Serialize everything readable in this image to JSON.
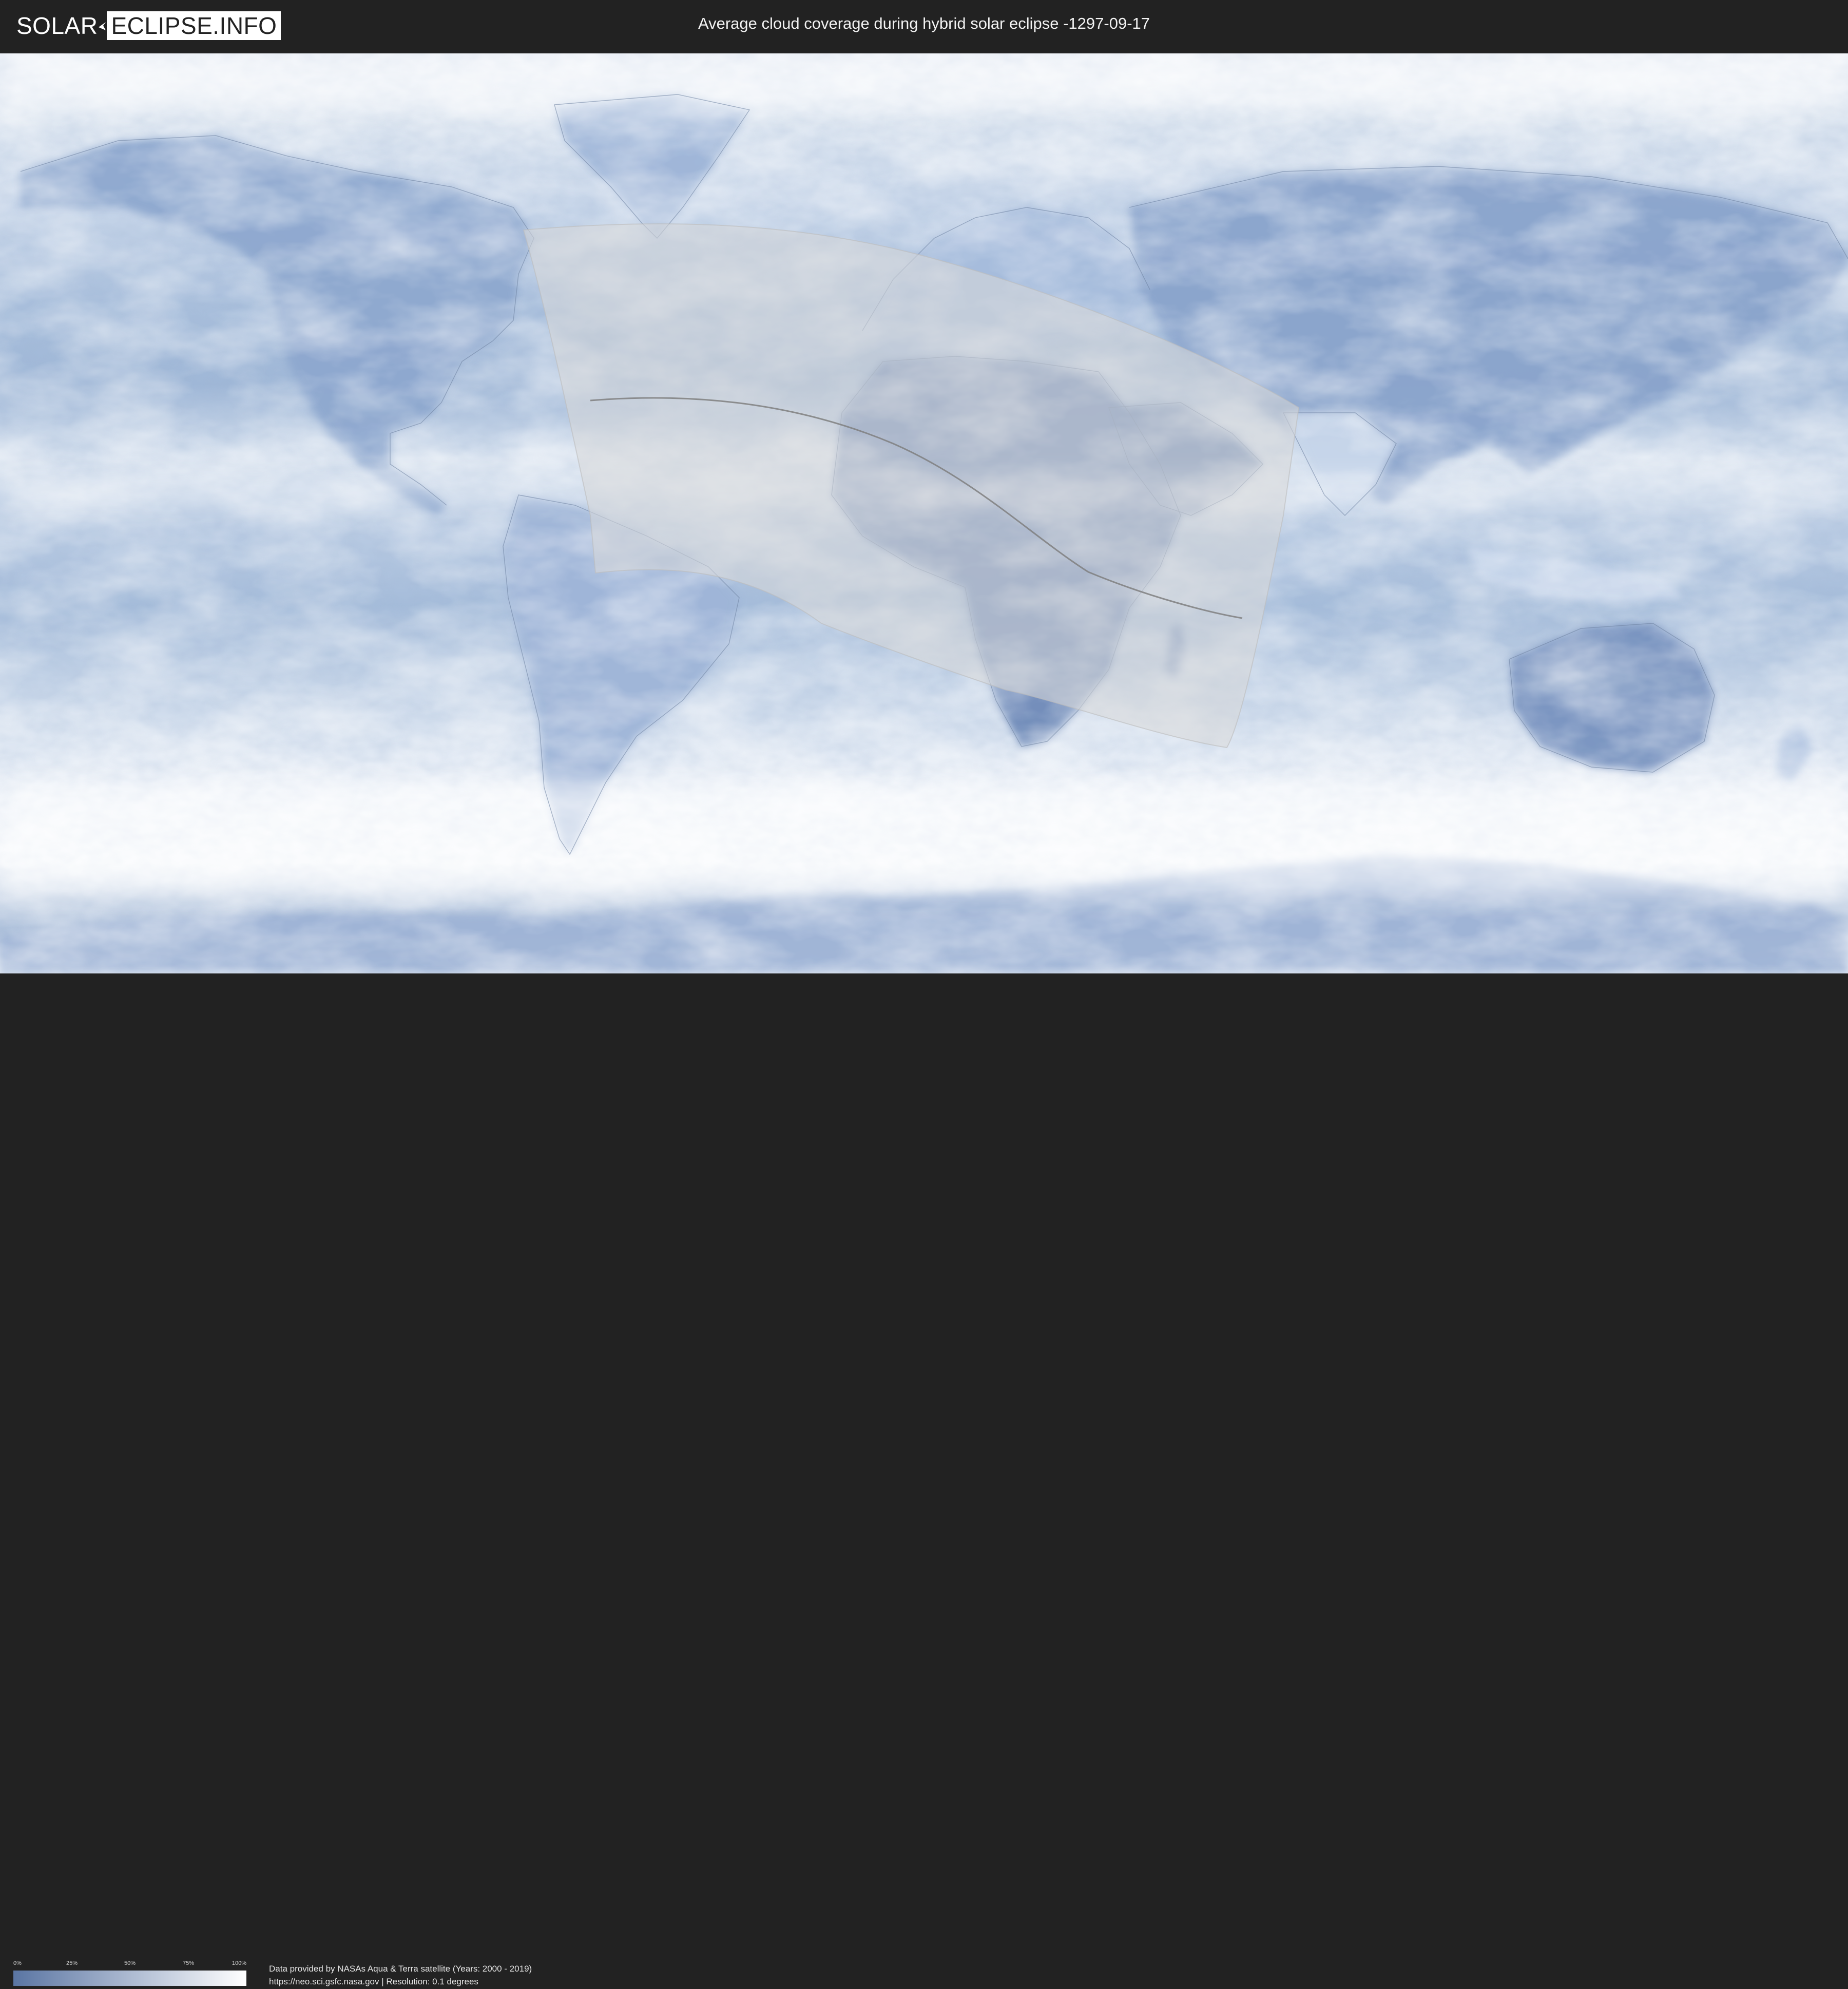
{
  "header": {
    "logo_left": "SOLAR",
    "logo_right": "ECLIPSE.INFO",
    "title": "Average cloud coverage during hybrid solar eclipse -1297-09-17"
  },
  "map": {
    "projection": "equirectangular",
    "layers": [
      "cloud-coverage",
      "country-borders",
      "eclipse-visibility-area",
      "eclipse-central-line"
    ],
    "colors": {
      "clear_sky": "#5a75a3",
      "full_cloud": "#ffffff",
      "eclipse_area": "#d8d8d8",
      "central_line": "#808080"
    }
  },
  "legend": {
    "ticks": [
      "0%",
      "25%",
      "50%",
      "75%",
      "100%"
    ],
    "gradient_start": "#5a75a3",
    "gradient_end": "#ffffff"
  },
  "footer": {
    "attribution_line1": "Data provided by NASAs Aqua & Terra satellite (Years: 2000 - 2019)",
    "attribution_line2": "https://neo.sci.gsfc.nasa.gov | Resolution: 0.1 degrees"
  }
}
